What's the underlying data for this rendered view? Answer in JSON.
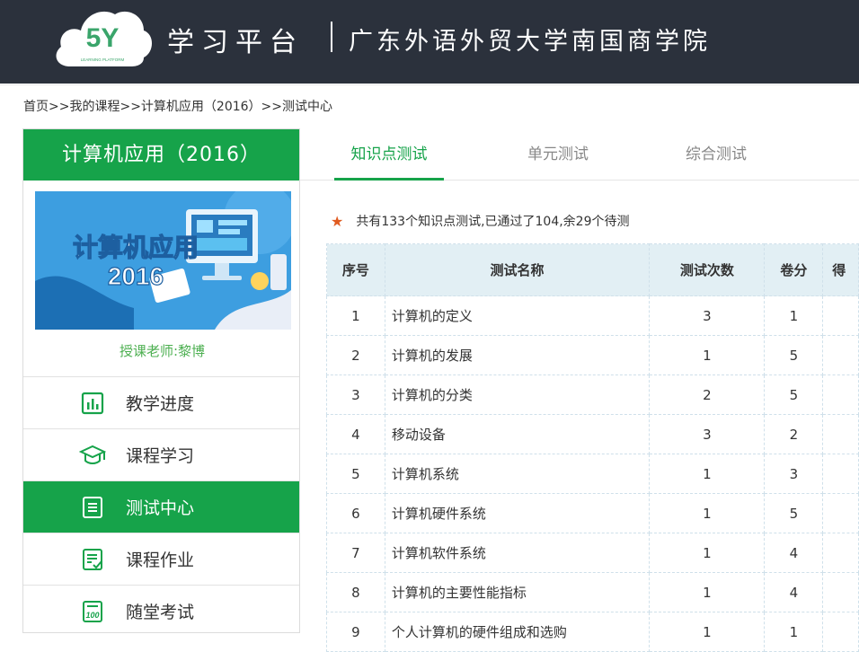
{
  "header": {
    "logo_text": "5Y",
    "logo_subtext": "LEARNING PLATFORM",
    "brand": "学习平台",
    "school": "广东外语外贸大学南国商学院"
  },
  "breadcrumb": "首页>>我的课程>>计算机应用（2016）>>测试中心",
  "sidebar": {
    "course_title": "计算机应用（2016）",
    "cover_title_line1": "计算机应用",
    "cover_title_line2": "2016",
    "teacher": "授课老师:黎博",
    "items": [
      {
        "label": "教学进度",
        "icon": "chart-icon"
      },
      {
        "label": "课程学习",
        "icon": "graduation-cap-icon"
      },
      {
        "label": "测试中心",
        "icon": "document-icon",
        "active": true
      },
      {
        "label": "课程作业",
        "icon": "checklist-icon"
      },
      {
        "label": "随堂考试",
        "icon": "exam-icon"
      }
    ]
  },
  "tabs": [
    {
      "label": "知识点测试",
      "active": true
    },
    {
      "label": "单元测试"
    },
    {
      "label": "综合测试"
    }
  ],
  "summary": "共有133个知识点测试,已通过了104,余29个待测",
  "table": {
    "headers": [
      "序号",
      "测试名称",
      "测试次数",
      "卷分",
      "得"
    ],
    "rows": [
      [
        "1",
        "计算机的定义",
        "3",
        "1"
      ],
      [
        "2",
        "计算机的发展",
        "1",
        "5"
      ],
      [
        "3",
        "计算机的分类",
        "2",
        "5"
      ],
      [
        "4",
        "移动设备",
        "3",
        "2"
      ],
      [
        "5",
        "计算机系统",
        "1",
        "3"
      ],
      [
        "6",
        "计算机硬件系统",
        "1",
        "5"
      ],
      [
        "7",
        "计算机软件系统",
        "1",
        "4"
      ],
      [
        "8",
        "计算机的主要性能指标",
        "1",
        "4"
      ],
      [
        "9",
        "个人计算机的硬件组成和选购",
        "1",
        "1"
      ]
    ]
  },
  "colors": {
    "accent": "#16a34a",
    "header_bg": "#2b313c",
    "star": "#e05a1f"
  }
}
